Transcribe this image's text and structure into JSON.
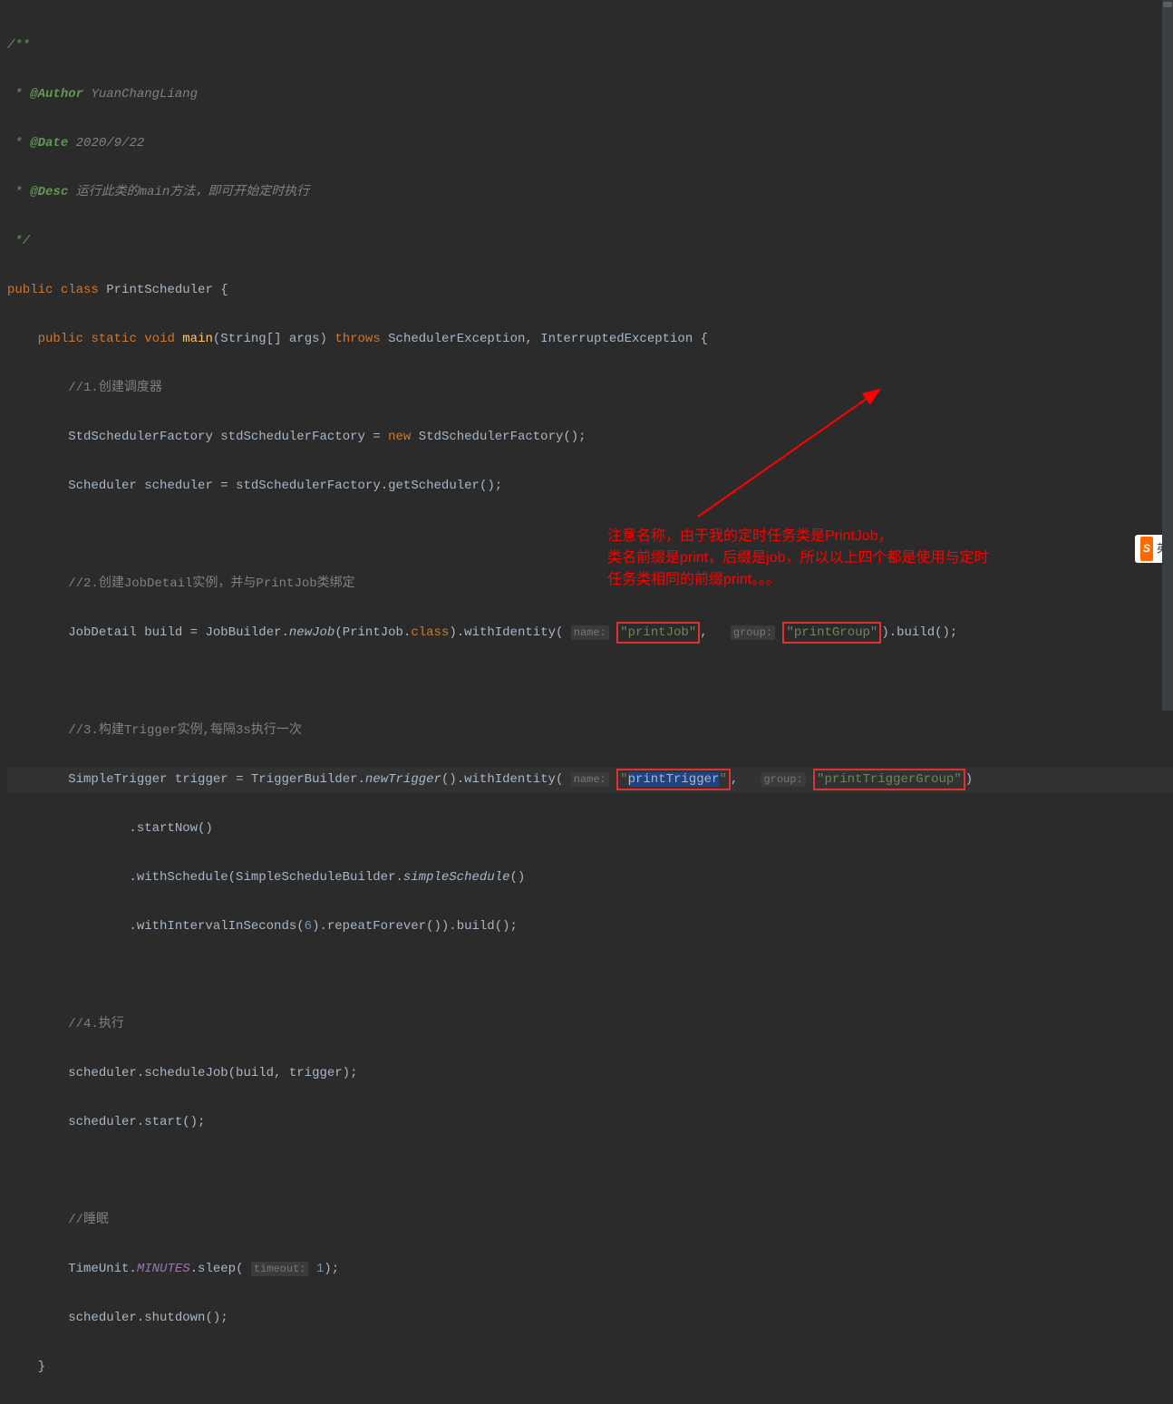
{
  "doc": {
    "open": "/**",
    "author_tag": "@Author",
    "author_val": "YuanChangLiang",
    "date_tag": "@Date",
    "date_val": "2020/9/22",
    "desc_tag": "@Desc",
    "desc_val": "运行此类的main方法，即可开始定时执行",
    "close": " */"
  },
  "class_decl": {
    "public": "public",
    "class_kw": "class",
    "name": "PrintScheduler",
    "brace": "{"
  },
  "main": {
    "public": "public",
    "static": "static",
    "void": "void",
    "name": "main",
    "params": "(String[] args)",
    "throws": "throws",
    "ex1": "SchedulerException",
    "comma": ",",
    "ex2": "InterruptedException",
    "brace": "{"
  },
  "c1": "//1.创建调度器",
  "l1a": {
    "type": "StdSchedulerFactory",
    "var": "stdSchedulerFactory",
    "eq": "=",
    "new_kw": "new",
    "ctor": "StdSchedulerFactory();"
  },
  "l1b": {
    "type": "Scheduler",
    "var": "scheduler",
    "eq": "=",
    "expr": "stdSchedulerFactory.getScheduler();"
  },
  "c2": "//2.创建JobDetail实例，并与PrintJob类绑定",
  "l2": {
    "type": "JobDetail",
    "var": "build",
    "eq": "=",
    "builder": "JobBuilder.",
    "newjob": "newJob",
    "arg1": "(PrintJob.",
    "class_kw": "class",
    "arg2": ").withIdentity(",
    "hint_name": "name:",
    "str_name": "\"printJob\"",
    "comma": ",",
    "hint_group": "group:",
    "str_group": "\"printGroup\"",
    "tail": ").build();"
  },
  "c3": "//3.构建Trigger实例,每隔3s执行一次",
  "l3": {
    "type": "SimpleTrigger",
    "var": "trigger",
    "eq": "=",
    "builder": "TriggerBuilder.",
    "newtrig": "newTrigger",
    "mid": "().withIdentity(",
    "hint_name": "name:",
    "str_name_q": "\"",
    "str_name_inner": "printTrigger",
    "str_name_q2": "\"",
    "comma": ",",
    "hint_group": "group:",
    "str_group": "\"printTriggerGroup\"",
    "tail": ")"
  },
  "l3b": ".startNow()",
  "l3c_pre": ".withSchedule(SimpleScheduleBuilder.",
  "l3c_static": "simpleSchedule",
  "l3c_post": "()",
  "l3d_pre": ".withIntervalInSeconds(",
  "l3d_num": "6",
  "l3d_post": ").repeatForever()).build();",
  "c4": "//4.执行",
  "l4a": "scheduler.scheduleJob(build, trigger);",
  "l4b": "scheduler.start();",
  "c5": "//睡眠",
  "l5a_pre": "TimeUnit.",
  "l5a_field": "MINUTES",
  "l5a_mid": ".sleep(",
  "l5a_hint": "timeout:",
  "l5a_num": "1",
  "l5a_post": ");",
  "l5b": "scheduler.shutdown();",
  "close_brace": "}",
  "annotation": {
    "line1": "注意名称，由于我的定时任务类是PrintJob，",
    "line2": "类名前缀是print，后缀是job，所以以上四个都是使用与定时",
    "line3": "任务类相同的前缀print。。。"
  },
  "ime": {
    "s": "S",
    "lang": "英"
  }
}
